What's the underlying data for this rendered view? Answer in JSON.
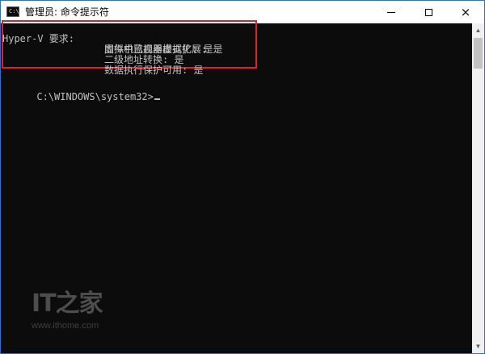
{
  "window": {
    "title": "管理员: 命令提示符",
    "app_icon_glyph": "C:\\"
  },
  "title_buttons": {
    "minimize": "minimize",
    "maximize": "maximize",
    "close": "×"
  },
  "console": {
    "requirements_label": "Hyper-V 要求:",
    "requirements": [
      "虚拟机监视器模式扩展: 是",
      "固件中已启用虚拟化: 是",
      "二级地址转换: 是",
      "数据执行保护可用: 是"
    ],
    "prompt": "C:\\WINDOWS\\system32>"
  },
  "scrollbar": {
    "up_arrow": "▲",
    "down_arrow": "▼"
  },
  "watermark": {
    "logo": "IT之家",
    "url": "www.ithome.com"
  },
  "colors": {
    "console_bg": "#0c0c0c",
    "console_text": "#c0c0c0",
    "highlight": "#e0202a",
    "window_border": "#2b6fcf"
  }
}
